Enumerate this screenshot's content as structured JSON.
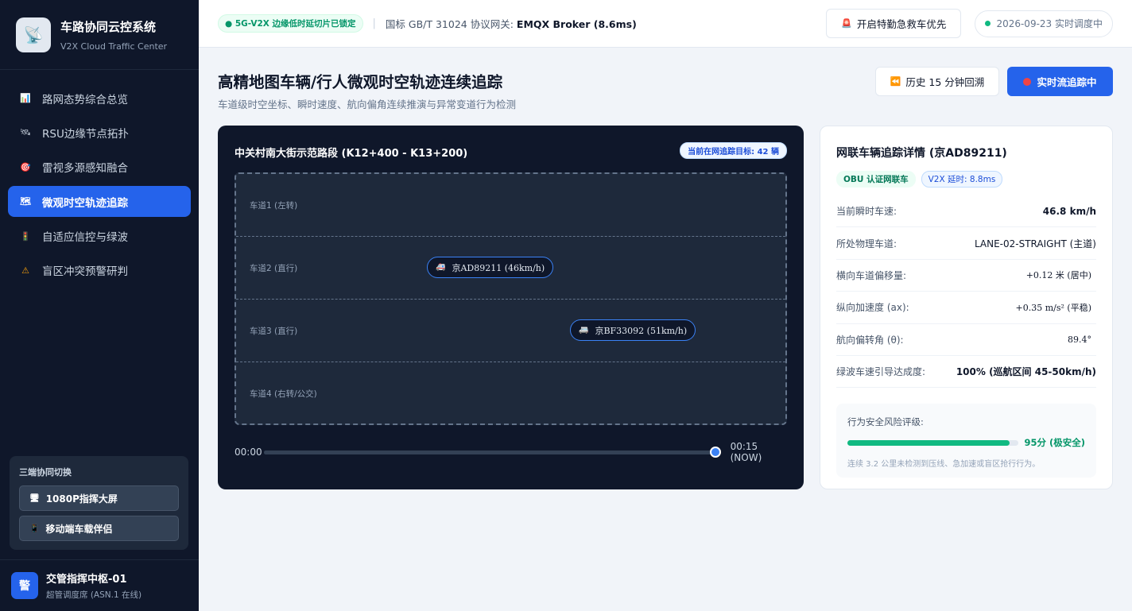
{
  "sidebar": {
    "brand_title": "车路协同云控系统",
    "brand_sub": "V2X Cloud Traffic Center",
    "brand_icon": "satellite-dish-icon",
    "items": [
      {
        "label": "路网态势综合总览",
        "icon": "bar-chart-icon",
        "active": false
      },
      {
        "label": "RSU边缘节点拓扑",
        "icon": "satellite-icon",
        "active": false
      },
      {
        "label": "雷视多源感知融合",
        "icon": "target-icon",
        "active": false
      },
      {
        "label": "微观时空轨迹追踪",
        "icon": "map-icon",
        "active": true
      },
      {
        "label": "自适应信控与绿波",
        "icon": "traffic-light-icon",
        "active": false
      },
      {
        "label": "盲区冲突预警研判",
        "icon": "warning-icon",
        "active": false
      }
    ],
    "switch_title": "三端协同切换",
    "switch_buttons": [
      "1080P指挥大屏",
      "移动端车载伴侣"
    ],
    "user_avatar": "警",
    "user_name": "交管指挥中枢-01",
    "user_role": "超管调度席 (ASN.1 在线)"
  },
  "header": {
    "slice_badge": "● 5G-V2X 边缘低时延切片已锁定",
    "separator": "|",
    "protocol_prefix": "国标 GB/T 31024 协议网关:",
    "protocol_value": "EMQX Broker (8.6ms)",
    "emergency_label": "开启特勤急救车优先",
    "date_label": "2026-09-23 实时调度中"
  },
  "page": {
    "title": "高精地图车辆/行人微观时空轨迹连续追踪",
    "subtitle": "车道级时空坐标、瞬时速度、航向偏角连续推演与异常变道行为检测",
    "history_label": "历史 15 分钟回溯",
    "live_label": "实时流追踪中"
  },
  "map": {
    "title": "中关村南大街示范路段 (K12+400 - K13+200)",
    "count_badge": "当前在网追踪目标: 42 辆",
    "lanes": [
      {
        "label": "车道1 (左转)",
        "vehicle": null
      },
      {
        "label": "车道2 (直行)",
        "vehicle": "京AD89211 (46km/h)"
      },
      {
        "label": "车道3 (直行)",
        "vehicle": "京BF33092 (51km/h)"
      },
      {
        "label": "车道4 (右转/公交)",
        "vehicle": null
      }
    ],
    "timeline_start": "00:00",
    "timeline_end": "00:15 (NOW)",
    "timeline_progress": 1.0
  },
  "detail": {
    "title": "网联车辆追踪详情 (京AD89211)",
    "tag_obu": "OBU 认证网联车",
    "tag_v2x": "V2X 延时: 8.8ms",
    "rows": [
      {
        "key": "当前瞬时车速:",
        "value": "46.8 km/h"
      },
      {
        "key": "所处物理车道:",
        "value": "LANE-02-STRAIGHT (主道)"
      },
      {
        "key": "横向车道偏移量:",
        "value": "+0.12 米 (居中)"
      },
      {
        "key": "纵向加速度 (ax):",
        "value": "+0.35 m/s² (平稳)"
      },
      {
        "key": "航向偏转角 (θ):",
        "value": "89.4°"
      },
      {
        "key": "绿波车速引导达成度:",
        "value": "100% (巡航区间 45-50km/h)"
      }
    ],
    "risk_label": "行为安全风险评级:",
    "risk_score": "95分 (极安全)",
    "risk_value": 0.95,
    "risk_note": "连续 3.2 公里未检测到压线、急加速或盲区抢行行为。"
  }
}
